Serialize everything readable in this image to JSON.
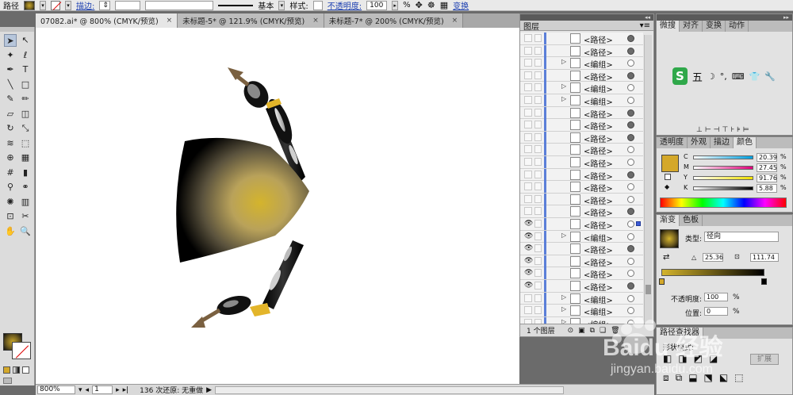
{
  "control_bar": {
    "object_type": "路径",
    "stroke_label": "描边:",
    "stroke_value": "",
    "brush_label": "基本",
    "style_label": "样式:",
    "opacity_label": "不透明度:",
    "opacity_value": "100",
    "opacity_unit": "%",
    "transform_label": "变换"
  },
  "doc_tabs": [
    {
      "label": "07082.ai* @ 800% (CMYK/预览)",
      "active": true
    },
    {
      "label": "未标题-5* @ 121.9% (CMYK/预览)",
      "active": false
    },
    {
      "label": "未标题-7* @ 200% (CMYK/预览)",
      "active": false
    }
  ],
  "tab_close_glyph": "×",
  "toolbar": {
    "tools": [
      {
        "name": "selection-tool",
        "glyph": "➤"
      },
      {
        "name": "direct-selection-tool",
        "glyph": "↖"
      },
      {
        "name": "magic-wand-tool",
        "glyph": "✦"
      },
      {
        "name": "lasso-tool",
        "glyph": "ℓ"
      },
      {
        "name": "pen-tool",
        "glyph": "✒"
      },
      {
        "name": "type-tool",
        "glyph": "T"
      },
      {
        "name": "line-tool",
        "glyph": "╲"
      },
      {
        "name": "rectangle-tool",
        "glyph": "□"
      },
      {
        "name": "paintbrush-tool",
        "glyph": "✎"
      },
      {
        "name": "pencil-tool",
        "glyph": "✏"
      },
      {
        "name": "blob-brush-tool",
        "glyph": "▱"
      },
      {
        "name": "eraser-tool",
        "glyph": "◫"
      },
      {
        "name": "rotate-tool",
        "glyph": "↻"
      },
      {
        "name": "scale-tool",
        "glyph": "⤡"
      },
      {
        "name": "width-tool",
        "glyph": "≋"
      },
      {
        "name": "free-transform-tool",
        "glyph": "⬚"
      },
      {
        "name": "shape-builder-tool",
        "glyph": "⊕"
      },
      {
        "name": "perspective-grid-tool",
        "glyph": "▦"
      },
      {
        "name": "mesh-tool",
        "glyph": "#"
      },
      {
        "name": "gradient-tool",
        "glyph": "▮"
      },
      {
        "name": "eyedropper-tool",
        "glyph": "⚲"
      },
      {
        "name": "blend-tool",
        "glyph": "⚭"
      },
      {
        "name": "symbol-sprayer-tool",
        "glyph": "✺"
      },
      {
        "name": "column-graph-tool",
        "glyph": "▥"
      },
      {
        "name": "artboard-tool",
        "glyph": "⊡"
      },
      {
        "name": "slice-tool",
        "glyph": "✂"
      },
      {
        "name": "hand-tool",
        "glyph": "✋"
      },
      {
        "name": "zoom-tool",
        "glyph": "🔍"
      }
    ]
  },
  "status_bar": {
    "zoom": "800%",
    "artboard": "1",
    "undo_status": "136 次还原: 无重做"
  },
  "layers_panel": {
    "title": "图层",
    "footer_count": "1 个图层",
    "rows": [
      {
        "label": "<路径>",
        "target": "filled",
        "expand": false,
        "visible": false
      },
      {
        "label": "<路径>",
        "target": "filled",
        "expand": false,
        "visible": false
      },
      {
        "label": "<编组>",
        "target": "empty",
        "expand": true,
        "visible": false
      },
      {
        "label": "<路径>",
        "target": "filled",
        "expand": false,
        "visible": false
      },
      {
        "label": "<编组>",
        "target": "empty",
        "expand": true,
        "visible": false
      },
      {
        "label": "<编组>",
        "target": "empty",
        "expand": true,
        "visible": false
      },
      {
        "label": "<路径>",
        "target": "filled",
        "expand": false,
        "visible": false
      },
      {
        "label": "<路径>",
        "target": "filled",
        "expand": false,
        "visible": false
      },
      {
        "label": "<路径>",
        "target": "filled",
        "expand": false,
        "visible": false
      },
      {
        "label": "<路径>",
        "target": "empty",
        "expand": false,
        "visible": false
      },
      {
        "label": "<路径>",
        "target": "empty",
        "expand": false,
        "visible": false
      },
      {
        "label": "<路径>",
        "target": "filled",
        "expand": false,
        "visible": false
      },
      {
        "label": "<路径>",
        "target": "empty",
        "expand": false,
        "visible": false
      },
      {
        "label": "<路径>",
        "target": "empty",
        "expand": false,
        "visible": false
      },
      {
        "label": "<路径>",
        "target": "filled",
        "expand": false,
        "visible": false
      },
      {
        "label": "<路径>",
        "target": "empty",
        "expand": false,
        "visible": true,
        "selected": true
      },
      {
        "label": "<编组>",
        "target": "empty",
        "expand": true,
        "visible": true
      },
      {
        "label": "<路径>",
        "target": "filled",
        "expand": false,
        "visible": true
      },
      {
        "label": "<路径>",
        "target": "empty",
        "expand": false,
        "visible": true
      },
      {
        "label": "<路径>",
        "target": "empty",
        "expand": false,
        "visible": true
      },
      {
        "label": "<路径>",
        "target": "filled",
        "expand": false,
        "visible": true
      },
      {
        "label": "<编组>",
        "target": "empty",
        "expand": true,
        "visible": false
      },
      {
        "label": "<编组>",
        "target": "empty",
        "expand": true,
        "visible": false
      },
      {
        "label": "<编组>",
        "target": "empty",
        "expand": true,
        "visible": false
      }
    ]
  },
  "glyph_panel": {
    "tabs": [
      "微搜",
      "对齐",
      "变换",
      "动作"
    ],
    "ime_label": "五"
  },
  "color_panel": {
    "tabs": [
      "透明度",
      "外观",
      "描边",
      "颜色"
    ],
    "channels": [
      {
        "label": "C",
        "value": "20.39",
        "unit": "%"
      },
      {
        "label": "M",
        "value": "27.45",
        "unit": "%"
      },
      {
        "label": "Y",
        "value": "91.76",
        "unit": "%"
      },
      {
        "label": "K",
        "value": "5.88",
        "unit": "%"
      }
    ],
    "fill_color": "#d4a82a"
  },
  "gradient_panel": {
    "tabs": [
      "渐变",
      "色板"
    ],
    "type_label": "类型:",
    "type_value": "径向",
    "angle_value": "25.36",
    "aspect_value": "111.74",
    "opacity_label": "不透明度:",
    "opacity_value": "100",
    "location_label": "位置:",
    "location_value": "0",
    "unit": "%"
  },
  "bottom_panel": {
    "tabs": [
      "路径查找器"
    ],
    "shape_mode_label": "形状模式:",
    "expand_label": "扩展"
  },
  "watermark": {
    "text": "Baidu 经验",
    "url": "jingyan.baidu.com"
  }
}
